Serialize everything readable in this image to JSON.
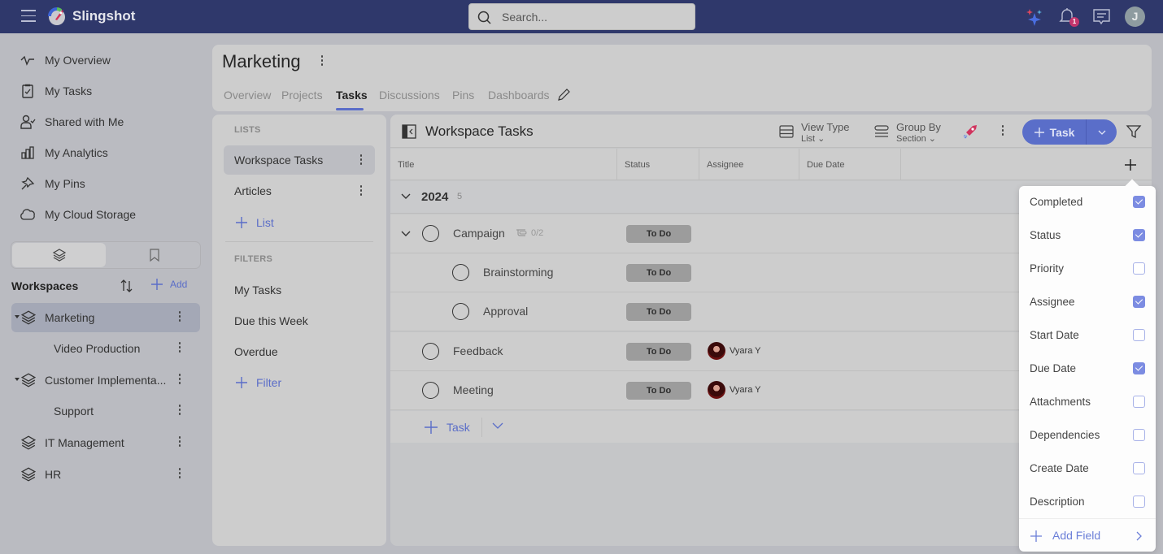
{
  "app": {
    "brand": "Slingshot",
    "search_placeholder": "Search...",
    "notifications_count": "1",
    "user_initial": "J"
  },
  "sidebar": {
    "nav": [
      {
        "label": "My Overview",
        "icon": "activity-icon"
      },
      {
        "label": "My Tasks",
        "icon": "clipboard-check-icon"
      },
      {
        "label": "Shared with Me",
        "icon": "user-check-icon"
      },
      {
        "label": "My Analytics",
        "icon": "bar-chart-icon"
      },
      {
        "label": "My Pins",
        "icon": "pin-icon"
      },
      {
        "label": "My Cloud Storage",
        "icon": "cloud-icon"
      }
    ],
    "workspaces_title": "Workspaces",
    "add_label": "Add",
    "workspaces": [
      {
        "name": "Marketing",
        "level": 0,
        "expanded": true,
        "active": true
      },
      {
        "name": "Video Production",
        "level": 1
      },
      {
        "name": "Customer Implementa...",
        "level": 0,
        "expanded": true
      },
      {
        "name": "Support",
        "level": 1
      },
      {
        "name": "IT Management",
        "level": 0
      },
      {
        "name": "HR",
        "level": 0
      }
    ]
  },
  "workspace": {
    "title": "Marketing",
    "tabs": [
      "Overview",
      "Projects",
      "Tasks",
      "Discussions",
      "Pins",
      "Dashboards"
    ],
    "active_tab": "Tasks"
  },
  "lists_panel": {
    "lists_label": "LISTS",
    "lists": [
      "Workspace Tasks",
      "Articles"
    ],
    "active_list": "Workspace Tasks",
    "add_list_label": "List",
    "filters_label": "FILTERS",
    "filters": [
      "My Tasks",
      "Due this Week",
      "Overdue"
    ],
    "add_filter_label": "Filter"
  },
  "tasks": {
    "title": "Workspace Tasks",
    "view_type_label": "View Type",
    "view_type_value": "List",
    "group_by_label": "Group By",
    "group_by_value": "Section",
    "new_task_label": "Task",
    "columns": [
      "Title",
      "Status",
      "Assignee",
      "Due Date"
    ],
    "group": {
      "name": "2024",
      "count": "5"
    },
    "rows": [
      {
        "title": "Campaign",
        "status": "To Do",
        "assignee": "",
        "subtasks": "0/2",
        "level": 0,
        "expandable": true
      },
      {
        "title": "Brainstorming",
        "status": "To Do",
        "assignee": "",
        "level": 1
      },
      {
        "title": "Approval",
        "status": "To Do",
        "assignee": "",
        "level": 1
      },
      {
        "title": "Feedback",
        "status": "To Do",
        "assignee": "Vyara Y",
        "level": 0
      },
      {
        "title": "Meeting",
        "status": "To Do",
        "assignee": "Vyara Y",
        "level": 0
      }
    ],
    "add_task_label": "Task"
  },
  "fields_popover": {
    "fields": [
      {
        "label": "Completed",
        "checked": true
      },
      {
        "label": "Status",
        "checked": true
      },
      {
        "label": "Priority",
        "checked": false
      },
      {
        "label": "Assignee",
        "checked": true
      },
      {
        "label": "Start Date",
        "checked": false
      },
      {
        "label": "Due Date",
        "checked": true
      },
      {
        "label": "Attachments",
        "checked": false
      },
      {
        "label": "Dependencies",
        "checked": false
      },
      {
        "label": "Create Date",
        "checked": false
      },
      {
        "label": "Description",
        "checked": false
      }
    ],
    "add_field_label": "Add Field"
  },
  "colors": {
    "topbar": "#2f386b",
    "accent": "#5a6dc8",
    "status_pill": "#9c9c9c",
    "checkbox_on": "#7c8ce2"
  }
}
